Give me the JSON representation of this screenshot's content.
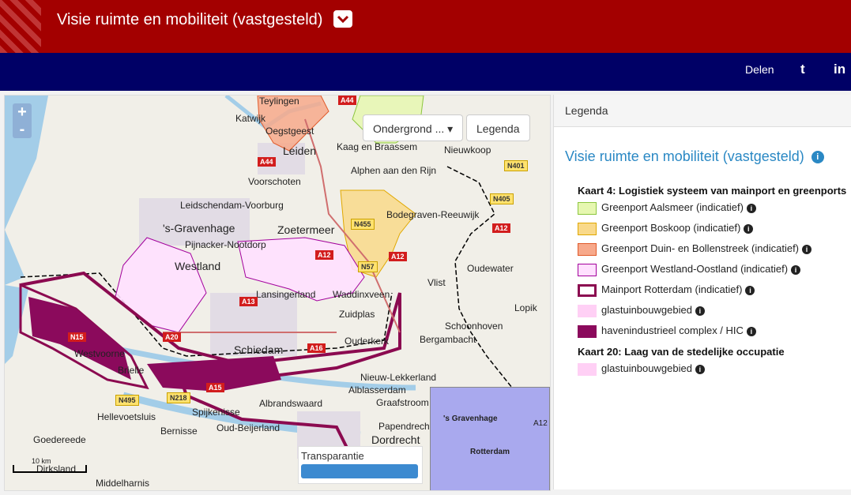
{
  "header": {
    "title": "Visie ruimte en mobiliteit (vastgesteld)"
  },
  "navbar": {
    "share_label": "Delen",
    "twitter": "t",
    "linkedin": "in"
  },
  "map": {
    "zoom_in": "+",
    "zoom_out": "-",
    "basemap_button": "Ondergrond ...",
    "legend_button": "Legenda",
    "transparency_label": "Transparantie",
    "scale_label": "10 km",
    "places": [
      "Teylingen",
      "Katwijk",
      "Oegstgeest",
      "Leiden",
      "Kaag en Braassem",
      "Nieuwkoop",
      "Voorschoten",
      "Alphen aan den Rijn",
      "Zoetermeer",
      "'s-Gravenhage",
      "Leidschendam-Voorburg",
      "Pijnacker-Nootdorp",
      "Westland",
      "Bodegraven-Reeuwijk",
      "Lansingerland",
      "Zuidplas",
      "Waddinxveen",
      "Vlist",
      "Oudewater",
      "Lopik",
      "Schoonhoven",
      "Westvoorne",
      "Brielle",
      "Schiedam",
      "Ouderkerk",
      "Bergambacht",
      "Nieuw-Lekkerland",
      "Alblasserdam",
      "Hellevoetsluis",
      "Spijkenisse",
      "Albrandswaard",
      "Graafstroom",
      "Bernisse",
      "Oud-Beijerland",
      "Papendrecht",
      "Goedereede",
      "Dordrecht",
      "Dirksland",
      "Middelharnis"
    ],
    "roads": [
      "A44",
      "A44",
      "N401",
      "N405",
      "A12",
      "A12",
      "N455",
      "A12",
      "A13",
      "A20",
      "A16",
      "N15",
      "N495",
      "N218",
      "A15",
      "N57"
    ],
    "minimap_labels": [
      "'s Gravenhage",
      "Rotterdam",
      "A12"
    ]
  },
  "legend": {
    "header": "Legenda",
    "title": "Visie ruimte en mobiliteit (vastgesteld)",
    "sections": [
      {
        "title": "Kaart 4: Logistiek systeem van mainport en greenports",
        "items": [
          {
            "label": "Greenport Aalsmeer (indicatief)",
            "color": "#e6f7b0",
            "border": "#8cc63f"
          },
          {
            "label": "Greenport Boskoop (indicatief)",
            "color": "#f9d98a",
            "border": "#e0a800"
          },
          {
            "label": "Greenport Duin- en Bollenstreek (indicatief)",
            "color": "#f7a98b",
            "border": "#e05a2b"
          },
          {
            "label": "Greenport Westland-Oostland (indicatief)",
            "color": "#ffe0ff",
            "border": "#a3009c"
          },
          {
            "label": "Mainport Rotterdam (indicatief)",
            "color": "#ffffff",
            "border": "#8b0a50"
          },
          {
            "label": "glastuinbouwgebied",
            "color": "#ffd0f5",
            "border": "#ffd0f5"
          },
          {
            "label": "havenindustrieel complex / HIC",
            "color": "#8b0a5c",
            "border": "#8b0a5c"
          }
        ]
      },
      {
        "title": "Kaart 20: Laag van de stedelijke occupatie",
        "items": [
          {
            "label": "glastuinbouwgebied",
            "color": "#ffd0f5",
            "border": "#ffd0f5"
          }
        ]
      }
    ]
  }
}
